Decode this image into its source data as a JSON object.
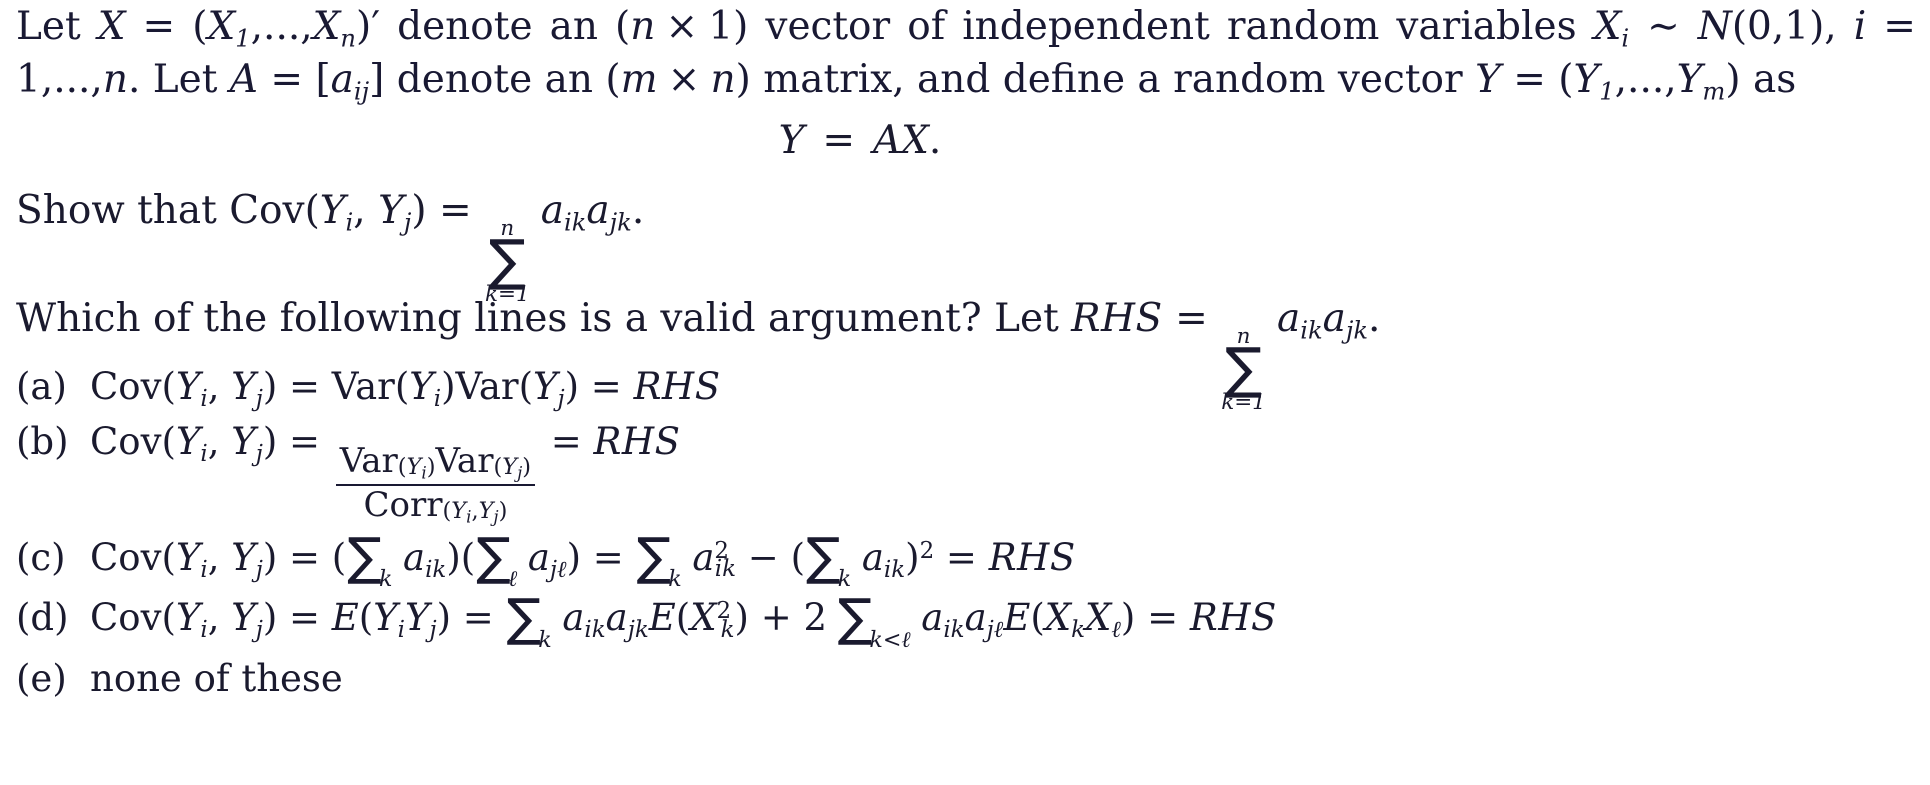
{
  "document": {
    "type": "mathematical-exam-question",
    "text_color": "#191933",
    "background_color": "#ffffff",
    "intro": {
      "segment_1": "Let ",
      "var_X": "X",
      "eq_1": " = ",
      "tuple_open": "(",
      "tuple_X1": "X",
      "tuple_X1_sub": "1",
      "tuple_dots": ",...,",
      "tuple_Xn": "X",
      "tuple_Xn_sub": "n",
      "tuple_close": ")",
      "prime": "′",
      "segment_2": " denote an ",
      "dim_open": "(",
      "dim_n": "n",
      "dim_times": "×",
      "dim_1": "1",
      "dim_close": ")",
      "segment_3": " vector of independent random variables ",
      "var_Xi": "X",
      "var_Xi_sub": "i",
      "tilde": "∼",
      "normal_N": "N",
      "normal_args": "(0,1),",
      "line2_i": "i",
      "line2_eq": " = 1,...,",
      "line2_n": "n",
      "line2_period": ". Let ",
      "var_A": "A",
      "eq_A": " = ",
      "bracket_open": "[",
      "a_ij": "a",
      "a_ij_sub": "ij",
      "bracket_close": "]",
      "segment_4": " denote an ",
      "dim_m": "m",
      "dim_times2": "×",
      "dim_n2": "n",
      "segment_5": " matrix, and define a random vector ",
      "var_Y": "Y",
      "eq_Y": " = ",
      "ytuple_Y1": "Y",
      "ytuple_Y1_sub": "1",
      "ytuple_dots": ",...,",
      "ytuple_Ym": "Y",
      "ytuple_Ym_sub": "m",
      "segment_6": " as"
    },
    "display_equation": {
      "lhs": "Y",
      "operator": "=",
      "rhs_A": "A",
      "rhs_X": "X",
      "period": "."
    },
    "show_that": {
      "prefix": "Show that ",
      "cov": "Cov",
      "open": "(",
      "Y_i": "Y",
      "Y_i_sub": "i",
      "comma": ", ",
      "Y_j": "Y",
      "Y_j_sub": "j",
      "close": ")",
      "eq": " = ",
      "sum_upper": "n",
      "sum_lower": "k=1",
      "term_a1": "a",
      "term_a1_sub": "ik",
      "term_a2": "a",
      "term_a2_sub": "jk",
      "period": "."
    },
    "question": {
      "prefix": "Which of the following lines is a valid argument?  Let ",
      "rhs_label": "RHS",
      "eq": " = ",
      "sum_upper": "n",
      "sum_lower": "k=1",
      "term_a1": "a",
      "term_a1_sub": "ik",
      "term_a2": "a",
      "term_a2_sub": "jk",
      "period": "."
    },
    "choices": [
      {
        "tag": "(a)",
        "id": "choice-a",
        "cov": "Cov",
        "Y_i": "Y",
        "Y_i_sub": "i",
        "Y_j": "Y",
        "Y_j_sub": "j",
        "var_label_1": "Var",
        "var_label_2": "Var",
        "result": "RHS",
        "plain": "Cov(Y_i, Y_j) = Var(Y_i)Var(Y_j) = RHS"
      },
      {
        "tag": "(b)",
        "id": "choice-b",
        "cov": "Cov",
        "numer_var1": "Var",
        "numer_var2": "Var",
        "denom_corr": "Corr",
        "result": "RHS",
        "plain": "Cov(Y_i, Y_j) = Var(Y_i)Var(Y_j) / Corr(Y_i,Y_j) = RHS"
      },
      {
        "tag": "(c)",
        "id": "choice-c",
        "cov": "Cov",
        "result": "RHS",
        "plain": "Cov(Y_i, Y_j) = (sum_k a_ik)(sum_l a_jl) = sum_k a_ik^2 - (sum_k a_ik)^2 = RHS"
      },
      {
        "tag": "(d)",
        "id": "choice-d",
        "cov": "Cov",
        "expectation": "E",
        "result": "RHS",
        "plain": "Cov(Y_i, Y_j) = E(Y_i Y_j) = sum_k a_ik a_jk E(X_k^2) + 2 sum_{k<l} a_ik a_jl E(X_k X_l) = RHS"
      },
      {
        "tag": "(e)",
        "id": "choice-e",
        "label": "none of these",
        "plain": "none of these"
      }
    ]
  }
}
